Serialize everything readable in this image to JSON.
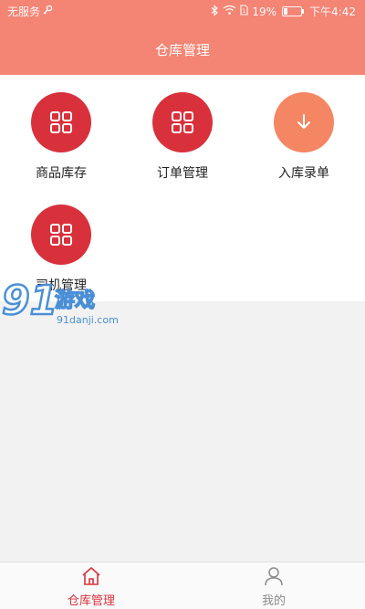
{
  "status_bar": {
    "carrier": "无服务",
    "battery": "19%",
    "time": "下午4:42"
  },
  "header": {
    "title": "仓库管理"
  },
  "tiles": [
    {
      "label": "商品库存",
      "icon": "grid-icon",
      "color": "#d9313b"
    },
    {
      "label": "订单管理",
      "icon": "grid-icon",
      "color": "#d9313b"
    },
    {
      "label": "入库录单",
      "icon": "arrow-down-icon",
      "color": "#f58664"
    },
    {
      "label": "司机管理",
      "icon": "grid-icon",
      "color": "#d9313b"
    }
  ],
  "watermark": {
    "logo": "91游戏",
    "site": "91danji.com"
  },
  "tabbar": {
    "tabs": [
      {
        "label": "仓库管理",
        "icon": "warehouse-home-icon",
        "active": true
      },
      {
        "label": "我的",
        "icon": "user-icon",
        "active": false
      }
    ]
  },
  "colors": {
    "header": "#f48474",
    "accent": "#d9313b",
    "orange": "#f58664"
  }
}
